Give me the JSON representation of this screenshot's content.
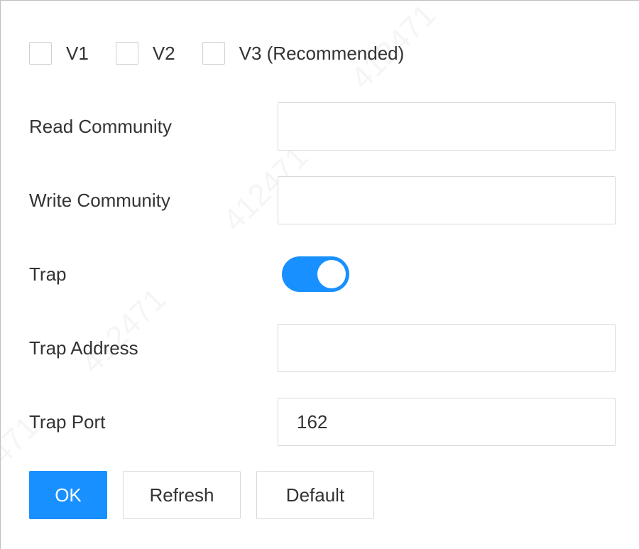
{
  "versions": [
    {
      "label": "V1",
      "checked": false
    },
    {
      "label": "V2",
      "checked": false
    },
    {
      "label": "V3 (Recommended)",
      "checked": false
    }
  ],
  "fields": {
    "read_community": {
      "label": "Read Community",
      "value": ""
    },
    "write_community": {
      "label": "Write Community",
      "value": ""
    },
    "trap": {
      "label": "Trap",
      "enabled": true
    },
    "trap_address": {
      "label": "Trap Address",
      "value": ""
    },
    "trap_port": {
      "label": "Trap Port",
      "value": "162"
    }
  },
  "buttons": {
    "ok": "OK",
    "refresh": "Refresh",
    "default": "Default"
  },
  "colors": {
    "accent": "#1890ff",
    "border": "#d9d9d9",
    "text": "#333333"
  }
}
